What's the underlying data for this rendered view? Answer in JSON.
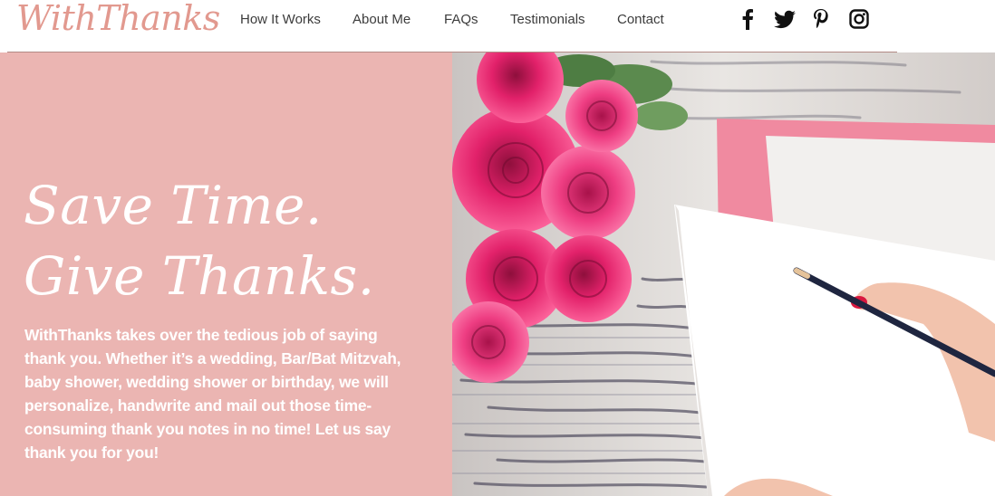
{
  "header": {
    "logo": "WithThanks",
    "nav": [
      "How It Works",
      "About Me",
      "FAQs",
      "Testimonials",
      "Contact"
    ],
    "social_icons": [
      "facebook-icon",
      "twitter-icon",
      "pinterest-icon",
      "instagram-icon"
    ]
  },
  "hero": {
    "headline_line1": "Save Time.",
    "headline_line2": "Give Thanks.",
    "body": "WithThanks takes over the tedious job of saying thank you. Whether it’s a wedding, Bar/Bat Mitzvah, baby shower, wedding shower or birthday, we will personalize, handwrite and mail out those time-consuming thank you notes in no time! Let us say thank you for you!",
    "image": "roses-and-handwritten-card-photo"
  },
  "colors": {
    "accent": "#e2998f",
    "panel": "#ebb5b2",
    "rose": "#e0195e",
    "nav_text": "#3c3c3c"
  }
}
